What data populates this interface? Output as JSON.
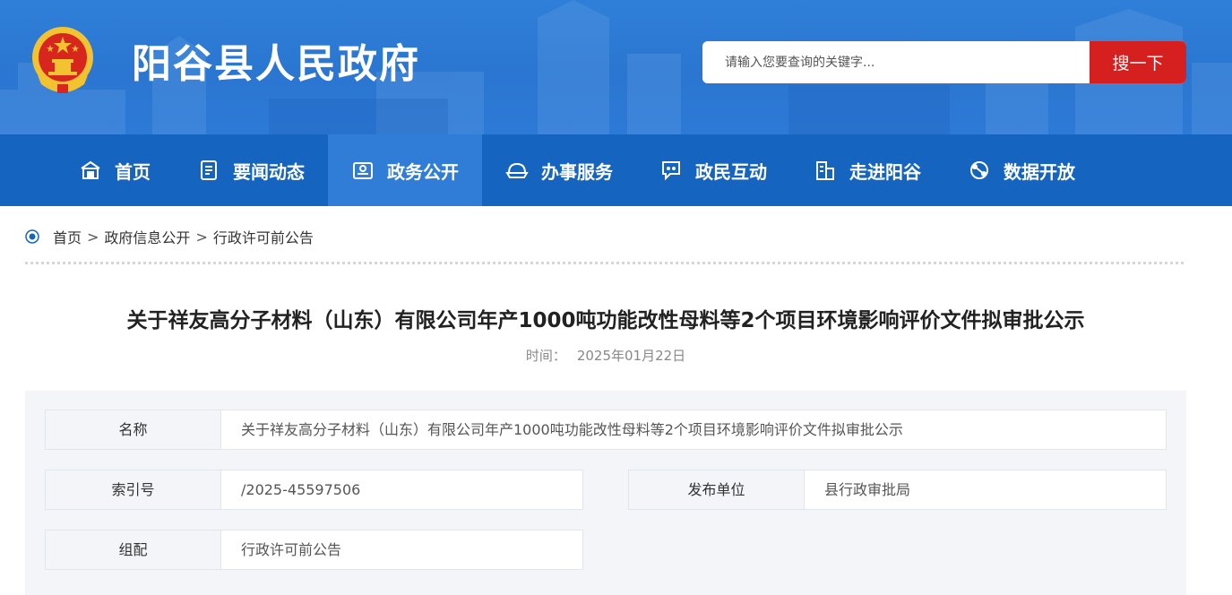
{
  "header": {
    "site_title": "阳谷县人民政府",
    "search_placeholder": "请输入您要查询的关键字...",
    "search_button": "搜一下"
  },
  "nav": [
    {
      "label": "首页",
      "icon": "home-icon"
    },
    {
      "label": "要闻动态",
      "icon": "news-icon"
    },
    {
      "label": "政务公开",
      "icon": "gov-info-icon",
      "active": true
    },
    {
      "label": "办事服务",
      "icon": "service-icon"
    },
    {
      "label": "政民互动",
      "icon": "chat-icon"
    },
    {
      "label": "走进阳谷",
      "icon": "building-icon"
    },
    {
      "label": "数据开放",
      "icon": "data-icon"
    }
  ],
  "breadcrumb": {
    "home": "首页",
    "sep": ">",
    "level1": "政府信息公开",
    "level2": "行政许可前公告"
  },
  "article": {
    "title": "关于祥友高分子材料（山东）有限公司年产1000吨功能改性母料等2个项目环境影响评价文件拟审批公示",
    "date_label": "时间：",
    "date": "2025年01月22日"
  },
  "info": {
    "name_label": "名称",
    "name_value": "关于祥友高分子材料（山东）有限公司年产1000吨功能改性母料等2个项目环境影响评价文件拟审批公示",
    "index_label": "索引号",
    "index_value": "/2025-45597506",
    "publisher_label": "发布单位",
    "publisher_value": "县行政审批局",
    "group_label": "组配",
    "group_value": "行政许可前公告"
  },
  "colors": {
    "header_blue": "#2f7fd8",
    "nav_blue": "#1565c0",
    "nav_active": "#2f7dd6",
    "search_red": "#d61f1f"
  }
}
